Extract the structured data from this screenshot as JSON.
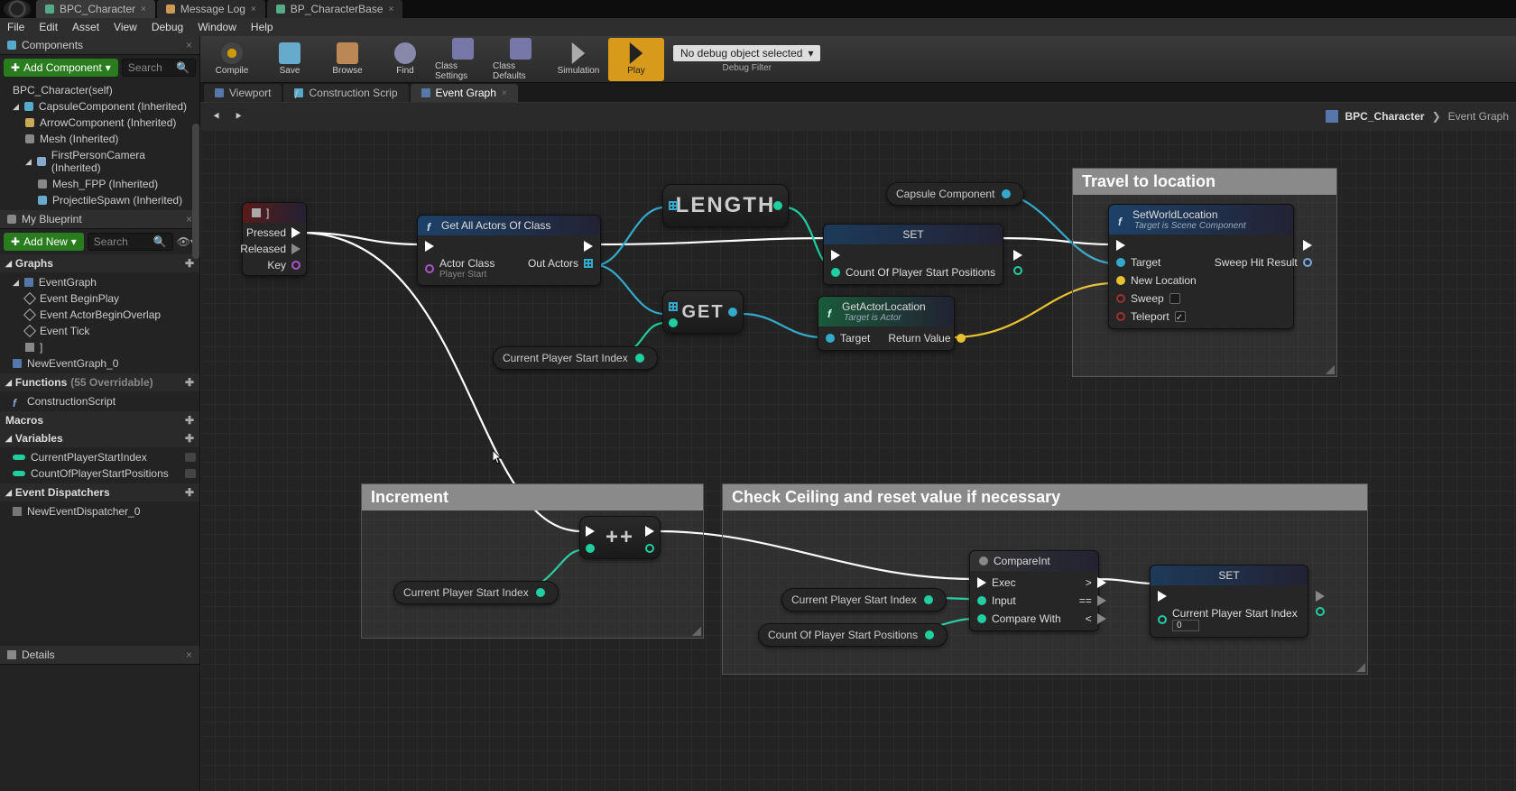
{
  "topTabs": [
    {
      "label": "BPC_Character",
      "active": true
    },
    {
      "label": "Message Log",
      "active": false
    },
    {
      "label": "BP_CharacterBase",
      "active": false
    }
  ],
  "menus": [
    "File",
    "Edit",
    "Asset",
    "View",
    "Debug",
    "Window",
    "Help"
  ],
  "toolbar": [
    {
      "label": "Compile",
      "cls": "ico-compile"
    },
    {
      "label": "Save",
      "cls": "ico-save"
    },
    {
      "label": "Browse",
      "cls": "ico-browse"
    },
    {
      "label": "Find",
      "cls": "ico-find"
    },
    {
      "label": "Class Settings",
      "cls": "ico-class"
    },
    {
      "label": "Class Defaults",
      "cls": "ico-def"
    },
    {
      "label": "Simulation",
      "cls": "ico-sim"
    },
    {
      "label": "Play",
      "cls": "ico-play",
      "active": true
    }
  ],
  "debugCombo": "No debug object selected",
  "debugLabel": "Debug Filter",
  "componentsPanel": {
    "title": "Components",
    "addLabel": "Add Component",
    "searchPlaceholder": "Search",
    "items": [
      {
        "label": "BPC_Character(self)",
        "indent": 1
      },
      {
        "label": "CapsuleComponent (Inherited)",
        "indent": 1,
        "arrow": true
      },
      {
        "label": "ArrowComponent (Inherited)",
        "indent": 2
      },
      {
        "label": "Mesh (Inherited)",
        "indent": 2
      },
      {
        "label": "FirstPersonCamera (Inherited)",
        "indent": 2,
        "arrow": true
      },
      {
        "label": "Mesh_FPP (Inherited)",
        "indent": 3
      },
      {
        "label": "ProjectileSpawn (Inherited)",
        "indent": 3
      }
    ]
  },
  "myBlueprint": {
    "title": "My Blueprint",
    "addLabel": "Add New",
    "searchPlaceholder": "Search",
    "sections": {
      "graphs": {
        "title": "Graphs",
        "items": [
          {
            "label": "EventGraph",
            "type": "graph",
            "arrow": true
          },
          {
            "label": "Event BeginPlay",
            "type": "event",
            "indent": 1
          },
          {
            "label": "Event ActorBeginOverlap",
            "type": "event",
            "indent": 1
          },
          {
            "label": "Event Tick",
            "type": "event",
            "indent": 1
          },
          {
            "label": "]",
            "type": "key",
            "indent": 1
          },
          {
            "label": "NewEventGraph_0",
            "type": "graph"
          }
        ]
      },
      "functions": {
        "title": "Functions",
        "suffix": "(55 Overridable)",
        "items": [
          {
            "label": "ConstructionScript",
            "type": "fn"
          }
        ]
      },
      "macros": {
        "title": "Macros",
        "items": []
      },
      "variables": {
        "title": "Variables",
        "items": [
          {
            "label": "CurrentPlayerStartIndex",
            "type": "var"
          },
          {
            "label": "CountOfPlayerStartPositions",
            "type": "var"
          }
        ]
      },
      "dispatchers": {
        "title": "Event Dispatchers",
        "items": [
          {
            "label": "NewEventDispatcher_0",
            "type": "dispatch"
          }
        ]
      }
    }
  },
  "detailsTitle": "Details",
  "graphTabs": [
    {
      "label": "Viewport",
      "icon": "grid"
    },
    {
      "label": "Construction Scrip",
      "icon": "fn"
    },
    {
      "label": "Event Graph",
      "icon": "grid",
      "active": true
    }
  ],
  "breadcrumb": {
    "root": "BPC_Character",
    "leaf": "Event Graph"
  },
  "comments": {
    "travel": "Travel to location",
    "increment": "Increment",
    "ceiling": "Check Ceiling and reset value if necessary"
  },
  "nodes": {
    "inputKey": {
      "key": "]",
      "pins": [
        "Pressed",
        "Released",
        "Key"
      ]
    },
    "getAll": {
      "title": "Get All Actors Of Class",
      "actorClass": "Actor Class",
      "actorClassValue": "Player Start",
      "out": "Out Actors"
    },
    "length": "LENGTH",
    "get": "GET",
    "set1": {
      "title": "SET",
      "pin": "Count Of Player Start Positions"
    },
    "capsule": "Capsule Component",
    "getActorLoc": {
      "title": "GetActorLocation",
      "sub": "Target is Actor",
      "target": "Target",
      "ret": "Return Value"
    },
    "setWorld": {
      "title": "SetWorldLocation",
      "sub": "Target is Scene Component",
      "pins": [
        "Target",
        "New Location",
        "Sweep",
        "Teleport"
      ],
      "out": "Sweep Hit Result"
    },
    "curIdx": "Current Player Start Index",
    "countPos": "Count Of Player Start Positions",
    "inc": "++",
    "compare": {
      "title": "CompareInt",
      "pins": [
        "Exec",
        "Input",
        "Compare With"
      ],
      "outs": [
        ">",
        "==",
        "<"
      ]
    },
    "set2": {
      "title": "SET",
      "pin": "Current Player Start Index",
      "val": "0"
    }
  }
}
